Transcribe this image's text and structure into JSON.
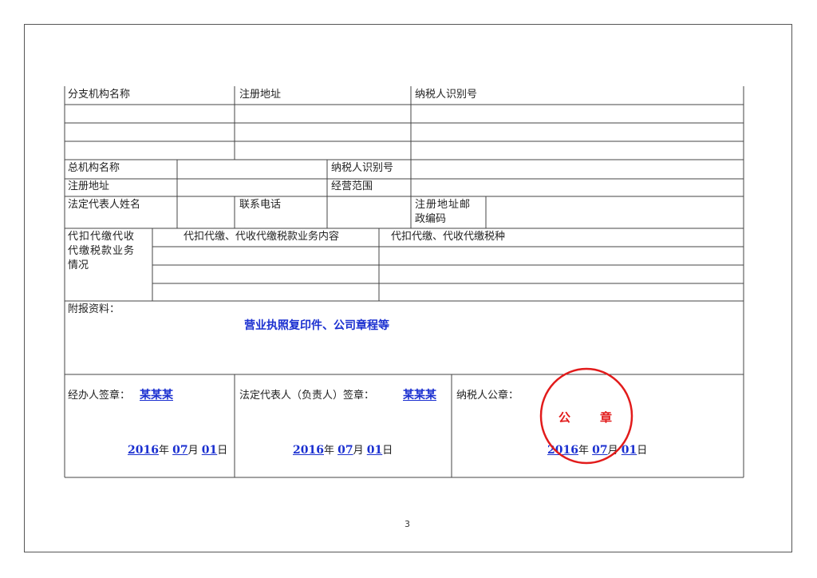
{
  "form": {
    "row1": {
      "branch_name": "分支机构名称",
      "reg_address": "注册地址",
      "taxpayer_id": "纳税人识别号"
    },
    "hq": {
      "name_label": "总机构名称",
      "taxpayer_id_label": "纳税人识别号",
      "reg_address_label": "注册地址",
      "business_scope_label": "经营范围",
      "legal_rep_label": "法定代表人姓名",
      "phone_label": "联系电话",
      "postcode_label_line1": "注册地址邮",
      "postcode_label_line2": "政编码"
    },
    "withholding": {
      "section_line1": "代扣代缴代收",
      "section_line2": "代缴税款业务",
      "section_line3": "情况",
      "content_header": "代扣代缴、代收代缴税款业务内容",
      "tax_type_header": "代扣代缴、代收代缴税种"
    },
    "attachments": {
      "label": "附报资料：",
      "value": "营业执照复印件、公司章程等"
    },
    "signatures": {
      "handler_label": "经办人签章：",
      "handler_value": "某某某",
      "legal_label": "法定代表人（负责人）签章：",
      "legal_value": "某某某",
      "taxpayer_seal_label": "纳税人公章：",
      "seal_text_1": "公",
      "seal_text_2": "章",
      "year": "2016",
      "month": "07",
      "day": "01",
      "year_unit": "年",
      "month_unit": "月",
      "day_unit": "日"
    }
  },
  "page_number": "3",
  "colors": {
    "fill_blue": "#1a2fd0",
    "seal_red": "#e21b1b"
  }
}
